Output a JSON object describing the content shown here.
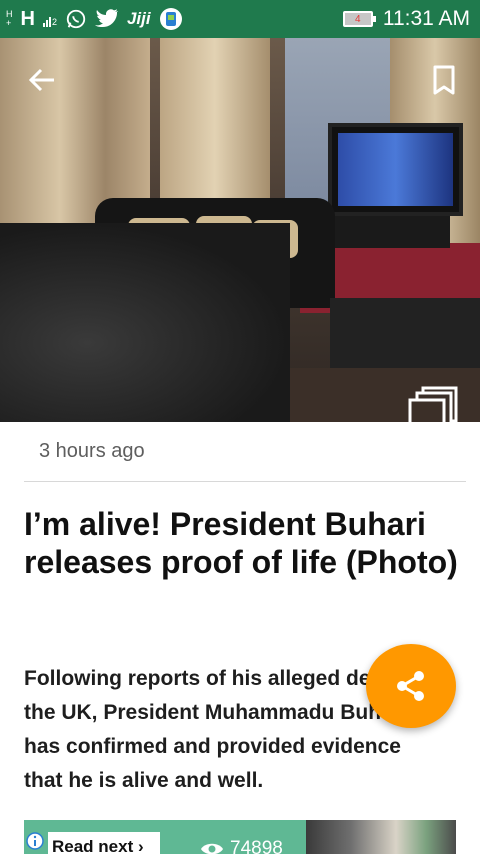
{
  "status_bar": {
    "network_h": "H",
    "network_h_small_top": "H",
    "network_h_small_bottom": "+",
    "signal_number": "2",
    "jiji_label": "Jiji",
    "battery_level": "4",
    "time": "11:31 AM"
  },
  "icons": {
    "back": "back-arrow-icon",
    "bookmark": "bookmark-icon",
    "gallery": "gallery-icon",
    "share": "share-icon"
  },
  "article": {
    "time_ago": "3 hours ago",
    "title": "I’m alive! President Buhari releases proof of life (Photo)",
    "lead": "Following reports of his alleged death in the UK, President Muhammadu Buhari has confirmed and provided evidence that he is alive and well."
  },
  "ad": {
    "button_label": "Read next",
    "views": "74898"
  },
  "colors": {
    "status_bar": "#1f7a4d",
    "fab": "#ff9800",
    "ad_bg": "#5fb894"
  }
}
